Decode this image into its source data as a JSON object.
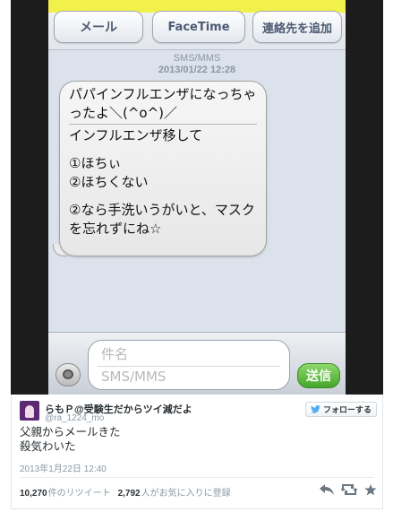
{
  "phone": {
    "actions": {
      "mail": "メール",
      "facetime": "FaceTime",
      "add_contact": "連絡先を追加"
    },
    "thread": {
      "message_type": "SMS/MMS",
      "date": "2013/01/22 12:28",
      "subject": "パパインフルエンザになっちゃったよ＼(^o^)／",
      "body_line1": "インフルエンザ移して",
      "option1": "①ほちぃ",
      "option2": "②ほちくない",
      "closing": "②なら手洗いうがいと、マスクを忘れずにね☆"
    },
    "compose": {
      "subject_placeholder": "件名",
      "body_placeholder": "SMS/MMS",
      "send_label": "送信"
    }
  },
  "tweet": {
    "display_name": "らもＰ@受験生だからツイ減だよ",
    "screen_name": "@ra_1224_mo",
    "follow_label": "フォローする",
    "text_line1": "父親からメールきた",
    "text_line2": "殺気わいた",
    "timestamp": "2013年1月22日 12:40",
    "retweet_count": "10,270",
    "retweet_label": "件のリツイート",
    "favorite_count": "2,792",
    "favorite_label": "人がお気に入りに登録"
  },
  "colors": {
    "twitter_blue": "#55acee",
    "send_green": "#44a52a",
    "bubble_gray": "#ececec"
  },
  "icons": [
    "camera-icon",
    "twitter-bird-icon",
    "reply-icon",
    "retweet-icon",
    "favorite-star-icon"
  ]
}
